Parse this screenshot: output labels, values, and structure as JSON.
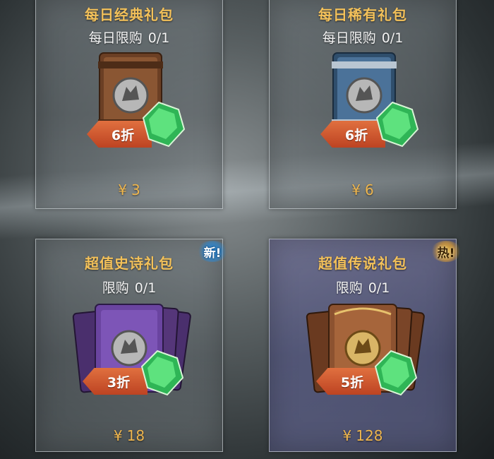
{
  "cards": [
    {
      "title": "每日经典礼包",
      "limit_label": "每日限购",
      "limit_value": "0/1",
      "discount": "6折",
      "currency": "¥",
      "price": "3",
      "pack_color": "#7a4a2c",
      "tag": ""
    },
    {
      "title": "每日稀有礼包",
      "limit_label": "每日限购",
      "limit_value": "0/1",
      "discount": "6折",
      "currency": "¥",
      "price": "6",
      "pack_color": "#3d6183",
      "tag": ""
    },
    {
      "title": "超值史诗礼包",
      "limit_label": "限购",
      "limit_value": "0/1",
      "discount": "3折",
      "currency": "¥",
      "price": "18",
      "pack_color": "#5b3a86",
      "tag": "新!"
    },
    {
      "title": "超值传说礼包",
      "limit_label": "限购",
      "limit_value": "0/1",
      "discount": "5折",
      "currency": "¥",
      "price": "128",
      "pack_color": "#7a4528",
      "tag": "热!"
    }
  ],
  "icons": {
    "pack": "card-pack-icon",
    "emblem": "wolf-emblem-icon",
    "gem": "green-gem-icon"
  },
  "colors": {
    "title": "#f3c15a",
    "price": "#efb64e",
    "discount": "#c94f29",
    "gem": "#3fd36a",
    "new_glow": "#288cdc",
    "hot_glow": "#f5be3c"
  }
}
